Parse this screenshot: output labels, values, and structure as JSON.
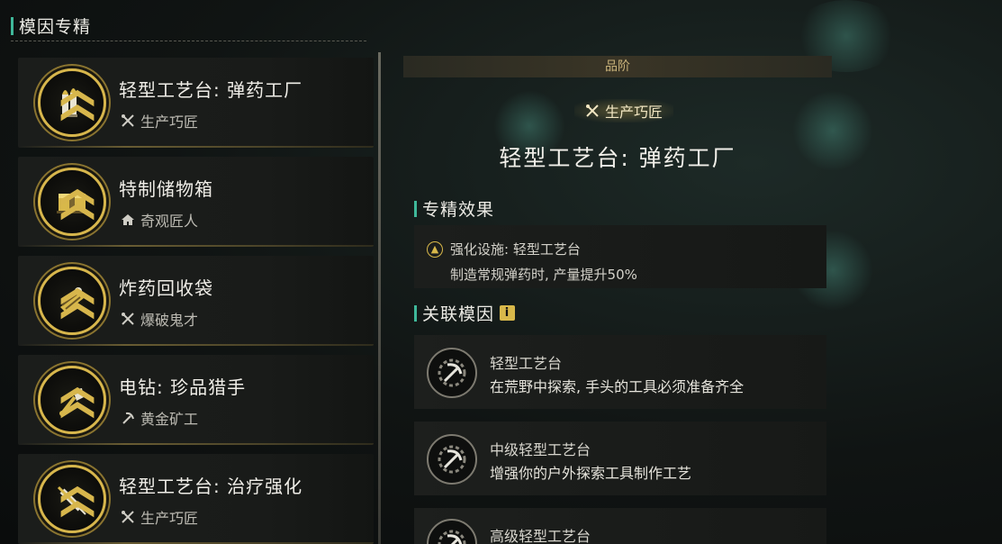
{
  "left_panel": {
    "title": "模因专精",
    "items": [
      {
        "name": "轻型工艺台: 弹药工厂",
        "category": "生产巧匠",
        "category_icon": "crossed-tools-icon",
        "medal_icon": "ammo-icon"
      },
      {
        "name": "特制储物箱",
        "category": "奇观匠人",
        "category_icon": "house-icon",
        "medal_icon": "crate-icon"
      },
      {
        "name": "炸药回收袋",
        "category": "爆破鬼才",
        "category_icon": "crossed-tools-icon",
        "medal_icon": "explosive-bag-icon"
      },
      {
        "name": "电钻: 珍品猎手",
        "category": "黄金矿工",
        "category_icon": "pickaxe-icon",
        "medal_icon": "drill-icon"
      },
      {
        "name": "轻型工艺台: 治疗强化",
        "category": "生产巧匠",
        "category_icon": "crossed-tools-icon",
        "medal_icon": "syringe-icon"
      }
    ]
  },
  "detail": {
    "grade_label": "品阶",
    "tag": "生产巧匠",
    "title": "轻型工艺台: 弹药工厂",
    "effect_section": {
      "title": "专精效果",
      "line1": "强化设施: 轻型工艺台",
      "line2": "制造常规弹药时, 产量提升50%"
    },
    "related_section": {
      "title": "关联模因",
      "info_label": "i",
      "genes": [
        {
          "name": "轻型工艺台",
          "desc": "在荒野中探索, 手头的工具必须准备齐全"
        },
        {
          "name": "中级轻型工艺台",
          "desc": "增强你的户外探索工具制作工艺"
        },
        {
          "name": "高级轻型工艺台",
          "desc": ""
        }
      ]
    }
  },
  "colors": {
    "accent_green": "#3fb89a",
    "gold": "#d7b64c"
  }
}
